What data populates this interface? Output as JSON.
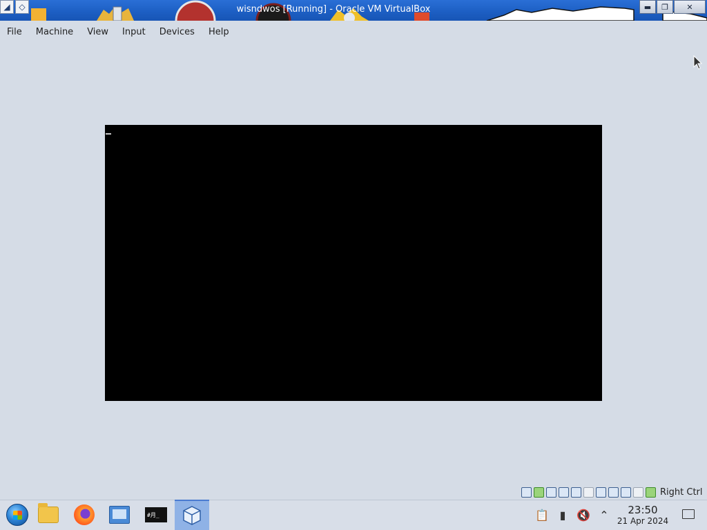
{
  "window": {
    "title": "wisndwos [Running] - Oracle VM VirtualBox"
  },
  "menu": {
    "items": [
      {
        "label": "File"
      },
      {
        "label": "Machine"
      },
      {
        "label": "View"
      },
      {
        "label": "Input"
      },
      {
        "label": "Devices"
      },
      {
        "label": "Help"
      }
    ]
  },
  "status_bar": {
    "host_key": "Right Ctrl"
  },
  "taskbar": {
    "apps": [
      {
        "name": "start-menu"
      },
      {
        "name": "file-manager"
      },
      {
        "name": "firefox"
      },
      {
        "name": "system-settings"
      },
      {
        "name": "terminal",
        "label": "#月_"
      },
      {
        "name": "virtualbox",
        "active": true
      }
    ],
    "clock": {
      "time": "23:50",
      "date": "21 Apr 2024"
    }
  }
}
